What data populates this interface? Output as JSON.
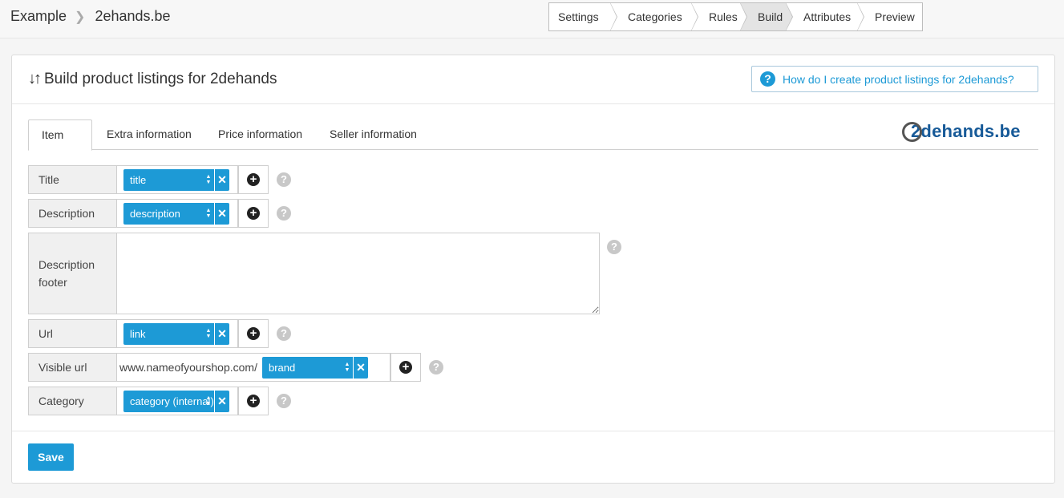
{
  "breadcrumb": {
    "root": "Example",
    "current": "2ehands.be"
  },
  "steps": [
    {
      "label": "Settings",
      "active": false
    },
    {
      "label": "Categories",
      "active": false
    },
    {
      "label": "Rules",
      "active": false
    },
    {
      "label": "Build",
      "active": true
    },
    {
      "label": "Attributes",
      "active": false
    },
    {
      "label": "Preview",
      "active": false
    }
  ],
  "panel": {
    "title": "Build product listings for 2dehands",
    "help_link": "How do I create product listings for 2dehands?"
  },
  "tabs": [
    {
      "label": "Item",
      "active": true
    },
    {
      "label": "Extra information",
      "active": false
    },
    {
      "label": "Price information",
      "active": false
    },
    {
      "label": "Seller information",
      "active": false
    }
  ],
  "logo_text": "2dehands.be",
  "rows": {
    "title": {
      "label": "Title",
      "value": "title"
    },
    "description": {
      "label": "Description",
      "value": "description"
    },
    "description_footer": {
      "label_line1": "Description",
      "label_line2": "footer",
      "value": ""
    },
    "url": {
      "label": "Url",
      "value": "link"
    },
    "visible_url": {
      "label": "Visible url",
      "prefix": "www.nameofyourshop.com/",
      "value": "brand"
    },
    "category": {
      "label": "Category",
      "value": "category (internal)"
    }
  },
  "save_label": "Save",
  "colors": {
    "accent": "#1d9ad6",
    "logo": "#175a98"
  }
}
